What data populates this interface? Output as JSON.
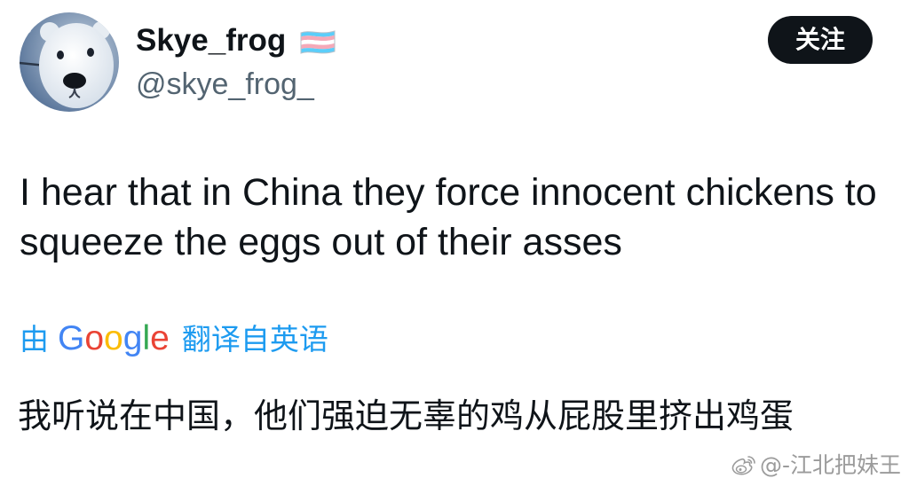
{
  "colors": {
    "text": "#0f1419",
    "secondary_text": "#536471",
    "accent": "#1d9bf0",
    "button_background": "#0f1419",
    "button_text": "#ffffff",
    "watermark": "#9b9b9b",
    "google_letters": [
      "#4285f4",
      "#ea4335",
      "#fbbc05",
      "#4285f4",
      "#34a853",
      "#ea4335"
    ]
  },
  "author": {
    "display_name": "Skye_frog",
    "name_badge_icon": "transgender-flag-icon",
    "handle": "@skye_frog_"
  },
  "follow_button": {
    "label": "关注"
  },
  "tweet": {
    "text_lines": [
      "I hear that in China they force innocent chickens to",
      "squeeze the eggs out of their asses"
    ]
  },
  "translation": {
    "prefix": "由",
    "provider": "Google",
    "suffix": "翻译自英语",
    "text": "我听说在中国，他们强迫无辜的鸡从屁股里挤出鸡蛋"
  },
  "watermark": {
    "icon": "weibo-icon",
    "text": "@-江北把妹王"
  }
}
